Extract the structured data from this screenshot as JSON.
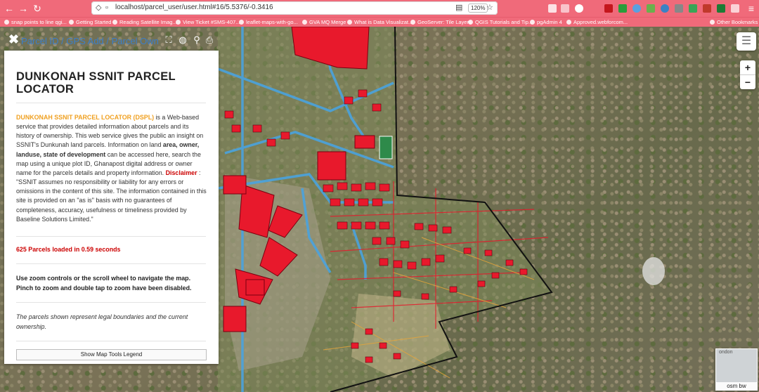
{
  "browser": {
    "url": "localhost/parcel_user/user.html#16/5.5376/-0.3416",
    "zoom": "120%",
    "bookmarks": [
      "snap points to line qgi...",
      "Getting Started",
      "Reading Satellite Imag...",
      "View Ticket #SMS-407...",
      "leaflet-maps-with-go...",
      "GVA MQ Merge",
      "What is Data Visualizat...",
      "GeoServer: Tile Layers",
      "QGIS Tutorials and Tip...",
      "pgAdmin 4",
      "Approved.webforcom...",
      "Other Bookmarks"
    ]
  },
  "panel": {
    "header_title": "Parcel ID / GPS Add / Parcel Own",
    "heading": "DUNKONAH SSNIT PARCEL LOCATOR",
    "intro": {
      "app_name": "DUNKONAH SSNIT PARCEL LOCATOR (DSPL)",
      "text1": " is a Web-based service that provides detailed information about parcels and its history of ownership. This web service gives the public an insight on SSNIT's Dunkunah land parcels. Information on land ",
      "bold_terms": "area, owner, landuse, state of development",
      "text2": " can be accessed here, search the map using a unique plot ID, Ghanapost digital address or owner name for the parcels details and property information. ",
      "disclaimer_label": "Disclaimer",
      "disclaimer_text": " : \"SSNIT assumes no responsibility or liability for any errors or omissions in the content of this site. The information contained in this site is provided on an \"as is\" basis with no guarantees of completeness, accuracy, usefulness or timeliness provided by Baseline Solutions Limited.\""
    },
    "status": "625 Parcels loaded in 0.59 seconds",
    "nav_help": "Use zoom controls or the scroll wheel to navigate the map. Pinch to zoom and double tap to zoom have been disabled.",
    "note": "The parcels shown represent legal boundaries and the current ownership.",
    "legend_button": "Show Map Tools Legend"
  },
  "map": {
    "zoom_in": "+",
    "zoom_out": "−",
    "minimap_text": "ondon",
    "minimap_label": "osm bw"
  },
  "colors": {
    "chrome": "#f06a7a",
    "parcel_fill": "#e8192c",
    "road_blue": "#4aa3df",
    "boundary": "#111111",
    "accent_title": "#3d7ec7"
  }
}
